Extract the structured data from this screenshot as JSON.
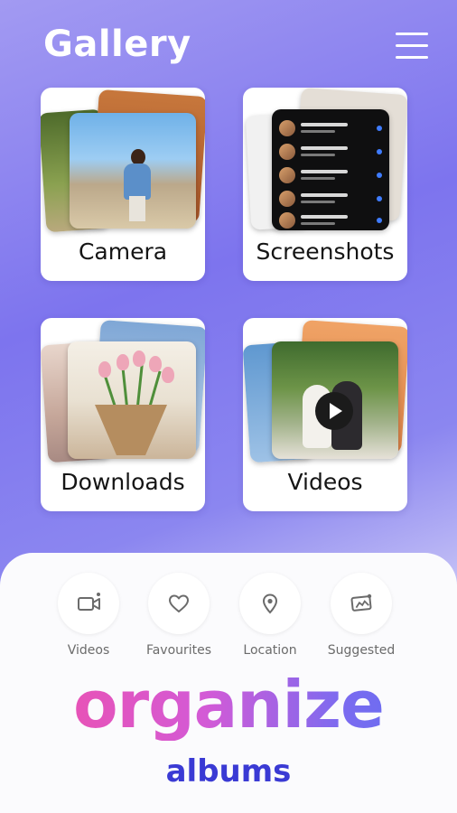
{
  "header": {
    "title": "Gallery",
    "menu_icon": "hamburger-menu-icon"
  },
  "albums": [
    {
      "label": "Camera"
    },
    {
      "label": "Screenshots"
    },
    {
      "label": "Downloads"
    },
    {
      "label": "Videos"
    }
  ],
  "quick_actions": [
    {
      "label": "Videos",
      "icon": "video-camera-icon"
    },
    {
      "label": "Favourites",
      "icon": "heart-icon"
    },
    {
      "label": "Location",
      "icon": "location-pin-icon"
    },
    {
      "label": "Suggested",
      "icon": "suggested-photo-icon"
    }
  ],
  "promo": {
    "headline": "organize",
    "subline": "albums"
  },
  "colors": {
    "background_top": "#a29af2",
    "background_mid": "#7d74ee",
    "headline_gradient_start": "#f24fa6",
    "headline_gradient_end": "#5a6ef2",
    "subline": "#3a3ad4",
    "icon_gray": "#6b6b6b"
  }
}
